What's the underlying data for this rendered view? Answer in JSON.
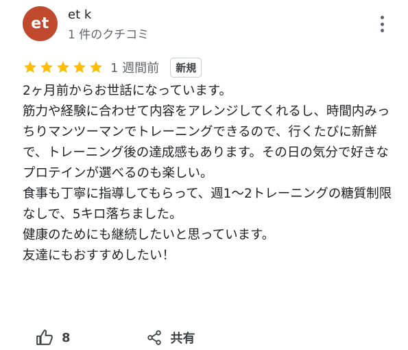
{
  "reviewer": {
    "avatar_initials": "et",
    "avatar_color": "#c0492d",
    "name": "et k",
    "review_count": "1 件のクチコミ"
  },
  "rating": {
    "stars": 5,
    "max_stars": 5,
    "star_color": "#fbbc04",
    "time_ago": "1 週間前",
    "badge": "新規"
  },
  "review": {
    "paragraphs": [
      "2ヶ月前からお世話になっています。",
      "筋力や経験に合わせて内容をアレンジしてくれるし、時間内みっちりマンツーマンでトレーニングできるので、行くたびに新鮮で、トレーニング後の達成感もあります。その日の気分で好きなプロテインが選べるのも楽しい。",
      "食事も丁寧に指導してもらって、週1〜2トレーニングの糖質制限なしで、5キロ落ちました。",
      "健康のためにも継続したいと思っています。",
      "友達にもおすすめしたい！"
    ]
  },
  "actions": {
    "like_icon": "thumb-up-icon",
    "like_count": "8",
    "share_icon": "share-icon",
    "share_label": "共有",
    "more_icon": "more-vert-icon"
  }
}
